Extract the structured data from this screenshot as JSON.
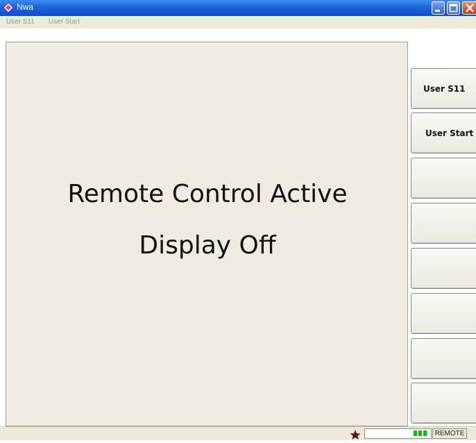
{
  "window": {
    "title": "Nwa",
    "controls": {
      "minimize": "minimize-icon",
      "maximize": "maximize-icon",
      "close": "close-icon"
    }
  },
  "menubar": {
    "items": [
      {
        "label": "User S11"
      },
      {
        "label": "User Start"
      }
    ]
  },
  "main": {
    "line1": "Remote Control Active",
    "line2": "Display Off"
  },
  "softkeys": [
    {
      "label": "User S11"
    },
    {
      "label": "User Start"
    },
    {
      "label": ""
    },
    {
      "label": ""
    },
    {
      "label": ""
    },
    {
      "label": ""
    },
    {
      "label": ""
    },
    {
      "label": ""
    }
  ],
  "statusbar": {
    "indicator_icon": "star-icon",
    "field_value": "",
    "mode_label": "REMOTE",
    "led_color": "#16b816"
  },
  "colors": {
    "titlebar": "#0b4bd0",
    "panel_background": "#f0ece1",
    "menubar_background": "#ece9d8"
  }
}
